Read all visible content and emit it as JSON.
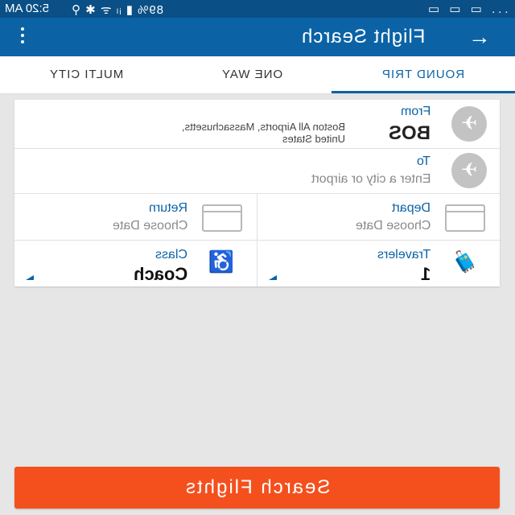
{
  "status": {
    "time": "5:20 AM",
    "battery": "89%",
    "icons_left": "▮ ᵢₗ ᯤ ✱ ⚲",
    "icons_right": "... ▭ ▭ ▭"
  },
  "appbar": {
    "title": "Flight Search",
    "menu_icon": "more-vert-icon",
    "back_icon": "arrow-back-icon"
  },
  "tabs": [
    {
      "label": "ROUND TRIP",
      "active": true
    },
    {
      "label": "ONE WAY",
      "active": false
    },
    {
      "label": "MULTI CITY",
      "active": false
    }
  ],
  "form": {
    "from": {
      "label": "From",
      "code": "BOS",
      "airport_line1": "Boston All Airports, Massachusetts,",
      "airport_line2": "United States"
    },
    "to": {
      "label": "To",
      "placeholder": "Enter a city or airport"
    },
    "depart": {
      "label": "Depart",
      "value": "Choose Date"
    },
    "return": {
      "label": "Return",
      "value": "Choose Date"
    },
    "travelers": {
      "label": "Travelers",
      "value": "1"
    },
    "class": {
      "label": "Class",
      "value": "Coach"
    }
  },
  "search_button": {
    "label": "Search Flights"
  },
  "colors": {
    "statusbar": "#0a4f86",
    "appbar": "#0b63a6",
    "accent": "#0b63a6",
    "cta": "#f4501e"
  }
}
